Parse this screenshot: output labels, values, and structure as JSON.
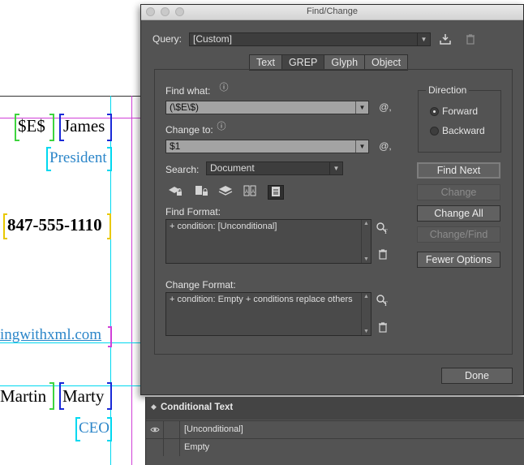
{
  "document": {
    "line1_marker": "$E$",
    "line1_name": "James",
    "line2_title": "President",
    "phone": "847-555-1110",
    "url_fragment": "ingwithxml.com",
    "line3_last": "Martin",
    "line3_first": "Marty",
    "line4_title": "CEO"
  },
  "dialog": {
    "title": "Find/Change",
    "query_label": "Query:",
    "query_value": "[Custom]",
    "save_query_icon": "save-query-icon",
    "delete_query_icon": "trash-icon",
    "tabs": [
      {
        "label": "Text",
        "active": false
      },
      {
        "label": "GREP",
        "active": true
      },
      {
        "label": "Glyph",
        "active": false
      },
      {
        "label": "Object",
        "active": false
      }
    ],
    "find_what_label": "Find what:",
    "find_what_value": "(\\$E\\$)",
    "change_to_label": "Change to:",
    "change_to_value": "$1",
    "special_char_icon": "@,",
    "search_label": "Search:",
    "search_value": "Document",
    "find_format_label": "Find Format:",
    "find_format_value": "+ condition: [Unconditional]",
    "change_format_label": "Change Format:",
    "change_format_value": "+ condition: Empty + conditions replace others",
    "direction_label": "Direction",
    "direction_forward": "Forward",
    "direction_backward": "Backward",
    "direction_selected": "Forward",
    "buttons": {
      "find_next": "Find Next",
      "change": "Change",
      "change_all": "Change All",
      "change_find": "Change/Find",
      "fewer_options": "Fewer Options",
      "done": "Done"
    }
  },
  "conditional_panel": {
    "title": "Conditional Text",
    "rows": [
      {
        "name": "[Unconditional]",
        "visible": true
      },
      {
        "name": "Empty",
        "visible": false
      }
    ]
  },
  "colors": {
    "dialog_bg": "#535353",
    "field_bg": "#a3a3a3",
    "document_blue": "#2c86c9",
    "guide_cyan": "#00d8f0",
    "guide_magenta": "#d040d8"
  }
}
